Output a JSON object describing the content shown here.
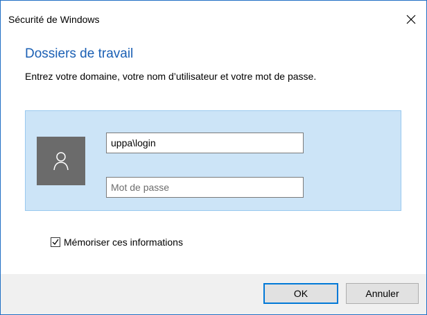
{
  "window": {
    "title": "Sécurité de Windows",
    "close_icon": "close-icon"
  },
  "header": {
    "heading": "Dossiers de travail",
    "subtitle": "Entrez votre domaine, votre nom d’utilisateur et votre mot de passe."
  },
  "credentials": {
    "avatar_icon": "user-icon",
    "username_value": "uppa\\login",
    "password_placeholder": "Mot de passe"
  },
  "remember": {
    "checked": true,
    "label": "Mémoriser ces informations"
  },
  "buttons": {
    "ok_label": "OK",
    "cancel_label": "Annuler"
  },
  "colors": {
    "accent": "#1a5fb4",
    "panel": "#cce4f7",
    "default_button_border": "#0078d7"
  }
}
